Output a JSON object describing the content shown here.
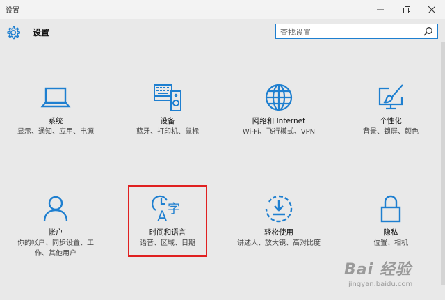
{
  "window": {
    "title": "设置",
    "minimize_icon": "minimize-icon",
    "maximize_icon": "restore-icon",
    "close_icon": "close-icon"
  },
  "header": {
    "icon": "gear-icon",
    "label": "设置"
  },
  "search": {
    "placeholder": "查找设置",
    "icon": "search-icon"
  },
  "accent_color": "#1e7fd0",
  "tiles": [
    {
      "icon": "laptop-icon",
      "name": "系统",
      "desc": "显示、通知、应用、电源"
    },
    {
      "icon": "keyboard-speaker-icon",
      "name": "设备",
      "desc": "蓝牙、打印机、鼠标"
    },
    {
      "icon": "globe-icon",
      "name": "网络和 Internet",
      "desc": "Wi-Fi、飞行模式、VPN"
    },
    {
      "icon": "paintbrush-monitor-icon",
      "name": "个性化",
      "desc": "背景、锁屏、颜色"
    },
    {
      "icon": "person-icon",
      "name": "帐户",
      "desc": "你的帐户、同步设置、工作、其他用户"
    },
    {
      "icon": "clock-language-icon",
      "name": "时间和语言",
      "desc": "语音、区域、日期"
    },
    {
      "icon": "accessibility-timer-icon",
      "name": "轻松使用",
      "desc": "讲述人、放大镜、高对比度"
    },
    {
      "icon": "padlock-icon",
      "name": "隐私",
      "desc": "位置、相机"
    }
  ],
  "watermark": {
    "line1": "Bai 经验",
    "line2": "jingyan.baidu.com"
  }
}
